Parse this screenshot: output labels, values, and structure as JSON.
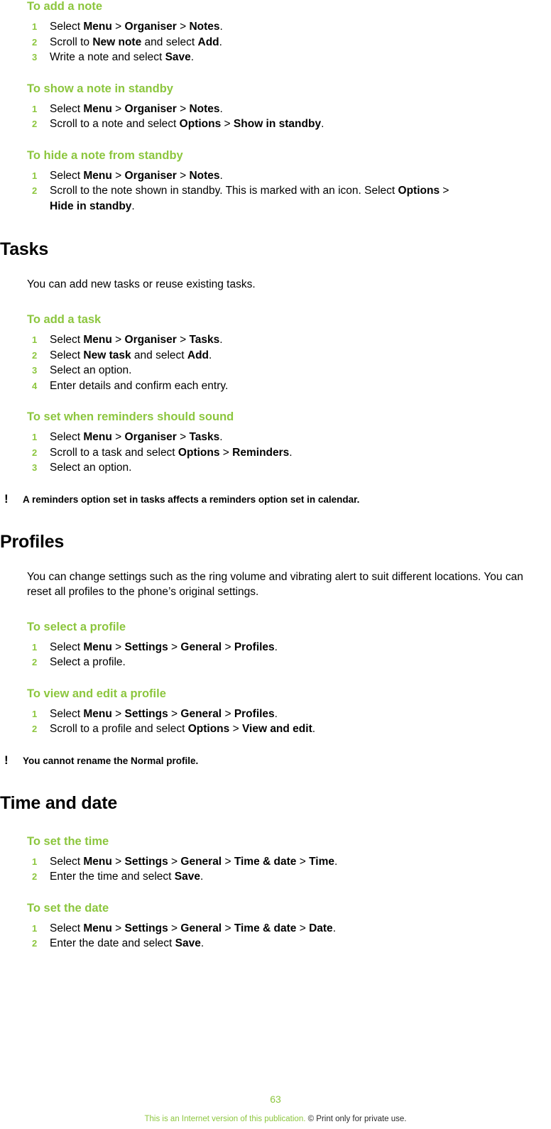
{
  "sections": [
    {
      "id": "notes-procedures",
      "title": null,
      "procedures": [
        {
          "title": "To add a note",
          "steps": [
            "Select <b>Menu</b> <span class=\"gt\">&gt;</span> <b>Organiser</b> <span class=\"gt\">&gt;</span> <b>Notes</b>.",
            "Scroll to <b>New note</b> and select <b>Add</b>.",
            "Write a note and select <b>Save</b>."
          ]
        },
        {
          "title": "To show a note in standby",
          "steps": [
            "Select <b>Menu</b> <span class=\"gt\">&gt;</span> <b>Organiser</b> <span class=\"gt\">&gt;</span> <b>Notes</b>.",
            "Scroll to a note and select <b>Options</b> <span class=\"gt\">&gt;</span> <b>Show in standby</b>."
          ]
        },
        {
          "title": "To hide a note from standby",
          "steps": [
            "Select <b>Menu</b> <span class=\"gt\">&gt;</span> <b>Organiser</b> <span class=\"gt\">&gt;</span> <b>Notes</b>.",
            "Scroll to the note shown in standby. This is marked with an icon. Select <b>Options</b> <span class=\"gt\">&gt;</span><br><b>Hide in standby</b>."
          ]
        }
      ]
    },
    {
      "id": "tasks",
      "title": "Tasks",
      "intro": "You can add new tasks or reuse existing tasks.",
      "procedures": [
        {
          "title": "To add a task",
          "steps": [
            "Select <b>Menu</b> <span class=\"gt\">&gt;</span> <b>Organiser</b> <span class=\"gt\">&gt;</span> <b>Tasks</b>.",
            "Select <b>New task</b> and select <b>Add</b>.",
            "Select an option.",
            "Enter details and confirm each entry."
          ]
        },
        {
          "title": "To set when reminders should sound",
          "steps": [
            "Select <b>Menu</b> <span class=\"gt\">&gt;</span> <b>Organiser</b> <span class=\"gt\">&gt;</span> <b>Tasks</b>.",
            "Scroll to a task and select <b>Options</b> <span class=\"gt\">&gt;</span> <b>Reminders</b>.",
            "Select an option."
          ]
        }
      ],
      "note": "A reminders option set in tasks affects a reminders option set in calendar."
    },
    {
      "id": "profiles",
      "title": "Profiles",
      "intro": "You can change settings such as the ring volume and vibrating alert to suit different locations. You can reset all profiles to the phone’s original settings.",
      "procedures": [
        {
          "title": "To select a profile",
          "steps": [
            "Select <b>Menu</b> <span class=\"gt\">&gt;</span> <b>Settings</b> <span class=\"gt\">&gt;</span> <b>General</b> <span class=\"gt\">&gt;</span> <b>Profiles</b>.",
            "Select a profile."
          ]
        },
        {
          "title": "To view and edit a profile",
          "steps": [
            "Select <b>Menu</b> <span class=\"gt\">&gt;</span> <b>Settings</b> <span class=\"gt\">&gt;</span> <b>General</b> <span class=\"gt\">&gt;</span> <b>Profiles</b>.",
            "Scroll to a profile and select <b>Options</b> <span class=\"gt\">&gt;</span> <b>View and edit</b>."
          ]
        }
      ],
      "note": "You cannot rename the <b>Normal</b> profile."
    },
    {
      "id": "time-and-date",
      "title": "Time and date",
      "procedures": [
        {
          "title": "To set the time",
          "steps": [
            "Select <b>Menu</b> <span class=\"gt\">&gt;</span> <b>Settings</b> <span class=\"gt\">&gt;</span> <b>General</b> <span class=\"gt\">&gt;</span> <b>Time &amp; date</b> <span class=\"gt\">&gt;</span> <b>Time</b>.",
            "Enter the time and select <b>Save</b>."
          ]
        },
        {
          "title": "To set the date",
          "steps": [
            "Select <b>Menu</b> <span class=\"gt\">&gt;</span> <b>Settings</b> <span class=\"gt\">&gt;</span> <b>General</b> <span class=\"gt\">&gt;</span> <b>Time &amp; date</b> <span class=\"gt\">&gt;</span> <b>Date</b>.",
            "Enter the date and select <b>Save</b>."
          ]
        }
      ]
    }
  ],
  "footer": {
    "page_number": "63",
    "disclaimer_part1": "This is an Internet version of this publication. ",
    "disclaimer_part2": "© Print only for private use."
  },
  "colors": {
    "accent_green": "#8cc63e",
    "text": "#000000"
  }
}
